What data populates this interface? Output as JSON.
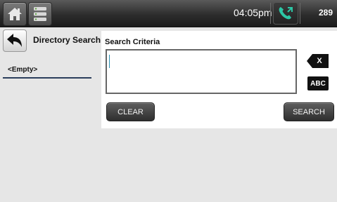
{
  "topbar": {
    "time": "04:05pm",
    "extension": "289"
  },
  "left": {
    "title": "Directory Search",
    "items": [
      {
        "label": "<Empty>"
      }
    ]
  },
  "main": {
    "title": "Search Criteria",
    "search_value": "",
    "backspace_label": "X",
    "abc_label": "ABC",
    "clear_label": "CLEAR",
    "search_label": "SEARCH"
  },
  "colors": {
    "phone_icon": "#2cc7a6",
    "list_underline": "#2b3e5c",
    "cursor": "#2a8fb0"
  },
  "icons": {
    "home": "home-icon",
    "menu": "list-menu-icon",
    "back": "back-arrow-icon",
    "phone": "phone-icon"
  }
}
